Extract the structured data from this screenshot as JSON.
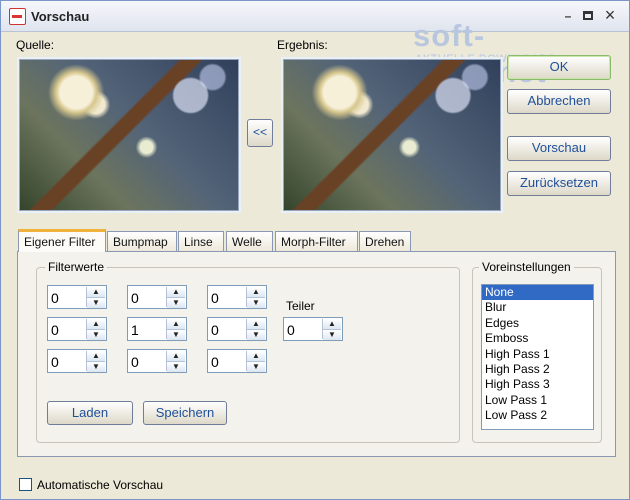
{
  "window": {
    "title": "Vorschau",
    "icon": "raw-icon",
    "controls": {
      "minimize": "–",
      "close": "×"
    }
  },
  "labels": {
    "source": "Quelle:",
    "result": "Ergebnis:"
  },
  "buttons": {
    "swap": "<<",
    "ok": "OK",
    "cancel": "Abbrechen",
    "preview": "Vorschau",
    "reset": "Zurücksetzen",
    "load": "Laden",
    "save": "Speichern"
  },
  "watermark": {
    "brand": "soft-ware.net",
    "subtitle": "AKTUELLE DOWNLOADS"
  },
  "tabs": [
    {
      "label": "Eigener Filter",
      "active": true
    },
    {
      "label": "Bumpmap"
    },
    {
      "label": "Linse"
    },
    {
      "label": "Welle"
    },
    {
      "label": "Morph-Filter"
    },
    {
      "label": "Drehen"
    }
  ],
  "filter": {
    "legend": "Filterwerte",
    "matrix": [
      "0",
      "0",
      "0",
      "0",
      "1",
      "0",
      "0",
      "0",
      "0"
    ],
    "divider_label": "Teiler",
    "divider_value": "0"
  },
  "presets": {
    "legend": "Voreinstellungen",
    "items": [
      "None",
      "Blur",
      "Edges",
      "Emboss",
      "High Pass 1",
      "High Pass 2",
      "High Pass 3",
      "Low Pass 1",
      "Low Pass 2"
    ],
    "selected_index": 0
  },
  "footer": {
    "auto_preview_label": "Automatische Vorschau",
    "checked": false
  },
  "colors": {
    "selection": "#316ac5",
    "active_tab": "#f0b23a",
    "watermark": "#b8c7df"
  }
}
